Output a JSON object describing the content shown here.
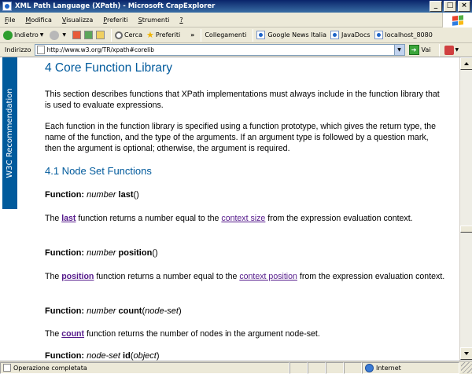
{
  "window": {
    "title": "XML Path Language (XPath) - Microsoft CrapExplorer",
    "minimize": "_",
    "maximize": "□",
    "close": "×"
  },
  "menu": [
    {
      "first": "F",
      "rest": "ile"
    },
    {
      "first": "M",
      "rest": "odifica"
    },
    {
      "first": "V",
      "rest": "isualizza"
    },
    {
      "first": "P",
      "rest": "referiti"
    },
    {
      "first": "S",
      "rest": "trumenti"
    },
    {
      "first": "?",
      "rest": ""
    }
  ],
  "toolbar": {
    "back": "Indietro",
    "search": "Cerca",
    "favorites": "Preferiti",
    "overflow": "»",
    "links_label": "Collegamenti",
    "links": [
      "Google News Italia",
      "JavaDocs",
      "localhost_8080"
    ]
  },
  "address": {
    "label": "Indirizzo",
    "url": "http://www.w3.org/TR/xpath#corelib",
    "go": "Vai"
  },
  "sidebar": {
    "label": "W3C Recommendation"
  },
  "doc": {
    "heading": "4 Core Function Library",
    "intro": "This section describes functions that XPath implementations must always include in the function library that is used to evaluate expressions.",
    "proto_para": "Each function in the function library is specified using a function prototype, which gives the return type, the name of the function, and the type of the arguments. If an argument type is followed by a question mark, then the argument is optional; otherwise, the argument is required.",
    "subheading": "4.1 Node Set Functions",
    "function_label": "Function:",
    "functions": [
      {
        "return_type": "number",
        "name": "last",
        "open": "(",
        "args": "",
        "close": ")",
        "desc_pre": "The ",
        "desc_kw": "last",
        "desc_mid": " function returns a number equal to the ",
        "desc_link": "context size",
        "desc_post": " from the expression evaluation context."
      },
      {
        "return_type": "number",
        "name": "position",
        "open": "(",
        "args": "",
        "close": ")",
        "desc_pre": "The ",
        "desc_kw": "position",
        "desc_mid": " function returns a number equal to the ",
        "desc_link": "context position",
        "desc_post": " from the expression evaluation context."
      },
      {
        "return_type": "number",
        "name": "count",
        "open": "(",
        "args": "node-set",
        "close": ")",
        "desc_pre": "The ",
        "desc_kw": "count",
        "desc_mid": " function returns the number of nodes in the argument node-set.",
        "desc_link": "",
        "desc_post": ""
      },
      {
        "return_type": "node-set",
        "name": "id",
        "open": "(",
        "args": "object",
        "close": ")"
      }
    ]
  },
  "status": {
    "text": "Operazione completata",
    "zone": "Internet"
  },
  "colors": {
    "heading": "#005a9c",
    "sidebar": "#005a9c",
    "link": "#551a8b",
    "titlebar": "#0a246a"
  }
}
